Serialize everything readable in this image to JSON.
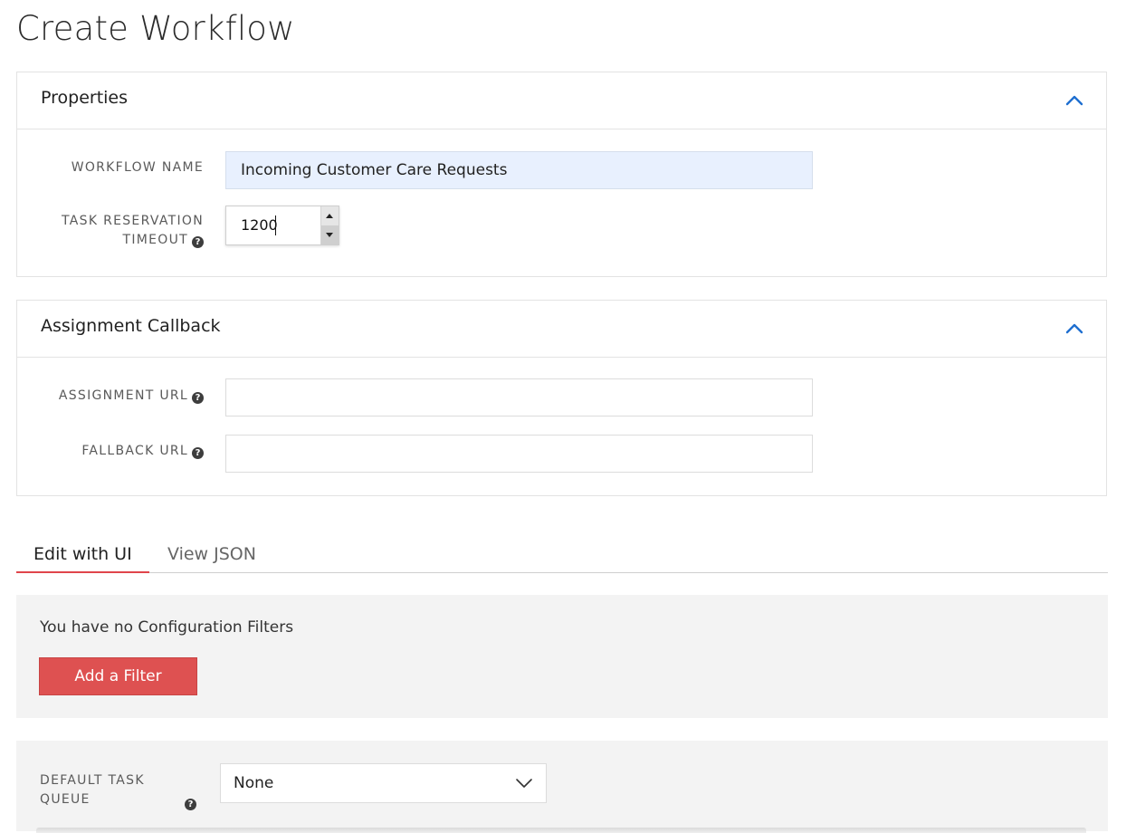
{
  "page": {
    "title": "Create Workflow"
  },
  "colors": {
    "accent_blue": "#1f6fd0",
    "brand_red": "#de5151",
    "tab_underline": "#e0454b"
  },
  "properties": {
    "title": "Properties",
    "collapse_icon": "chevron-up-icon",
    "workflow_name": {
      "label": "WORKFLOW NAME",
      "value": "Incoming Customer Care Requests"
    },
    "task_reservation_timeout": {
      "label_line1": "TASK RESERVATION",
      "label_line2": "TIMEOUT",
      "value": "1200",
      "help_icon": "question-circle-icon"
    }
  },
  "assignment_callback": {
    "title": "Assignment Callback",
    "collapse_icon": "chevron-up-icon",
    "assignment_url": {
      "label": "ASSIGNMENT URL",
      "value": "",
      "help_icon": "question-circle-icon"
    },
    "fallback_url": {
      "label": "FALLBACK URL",
      "value": "",
      "help_icon": "question-circle-icon"
    }
  },
  "tabs": [
    {
      "label": "Edit with UI",
      "active": true
    },
    {
      "label": "View JSON",
      "active": false
    }
  ],
  "filters": {
    "empty_text": "You have no Configuration Filters",
    "add_button_label": "Add a Filter"
  },
  "default_task_queue": {
    "label": "DEFAULT TASK QUEUE",
    "help_icon": "question-circle-icon",
    "selected": "None",
    "dropdown_icon": "chevron-down-icon"
  }
}
